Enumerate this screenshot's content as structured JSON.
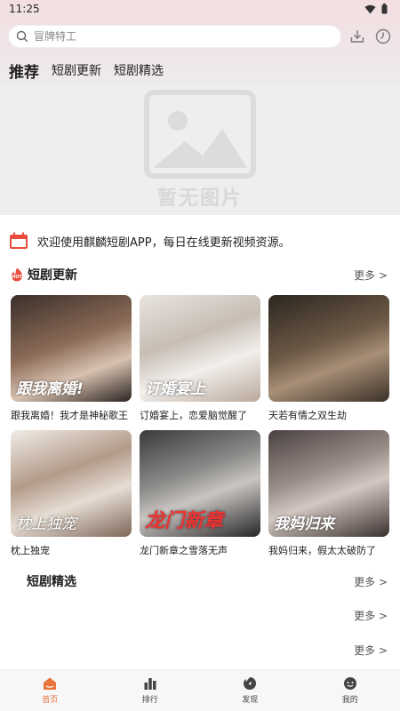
{
  "status": {
    "time": "11:25"
  },
  "search": {
    "placeholder": "冒牌特工"
  },
  "tabs": [
    {
      "label": "推荐",
      "active": true
    },
    {
      "label": "短剧更新",
      "active": false
    },
    {
      "label": "短剧精选",
      "active": false
    }
  ],
  "banner": {
    "placeholder_text": "暂无图片"
  },
  "notice": {
    "text": "欢迎使用麒麟短剧APP，每日在线更新视频资源。"
  },
  "section_updates": {
    "title": "短剧更新",
    "more": "更多 >",
    "items": [
      {
        "title": "跟我离婚！我才是神秘歌王",
        "poster_text": "跟我离婚!"
      },
      {
        "title": "订婚宴上，恋爱脑觉醒了",
        "poster_text": "订婚宴上"
      },
      {
        "title": "天若有情之双生劫",
        "poster_text": ""
      },
      {
        "title": "枕上独宠",
        "poster_text": "枕上独宠"
      },
      {
        "title": "龙门新章之雪落无声",
        "poster_text": "龙门新章"
      },
      {
        "title": "我妈归来，假太太破防了",
        "poster_text": "我妈归来"
      }
    ]
  },
  "section_featured": {
    "title": "短剧精选",
    "more": "更多 >",
    "more_2": "更多 >",
    "more_3": "更多 >"
  },
  "bottom_nav": [
    {
      "label": "首页",
      "icon": "home-icon",
      "active": true
    },
    {
      "label": "排行",
      "icon": "ranking-icon",
      "active": false
    },
    {
      "label": "发现",
      "icon": "discover-icon",
      "active": false
    },
    {
      "label": "我的",
      "icon": "profile-icon",
      "active": false
    }
  ],
  "colors": {
    "accent": "#e8743b",
    "notice_icon": "#e94b3c",
    "hot_badge": "#e94b3c"
  }
}
